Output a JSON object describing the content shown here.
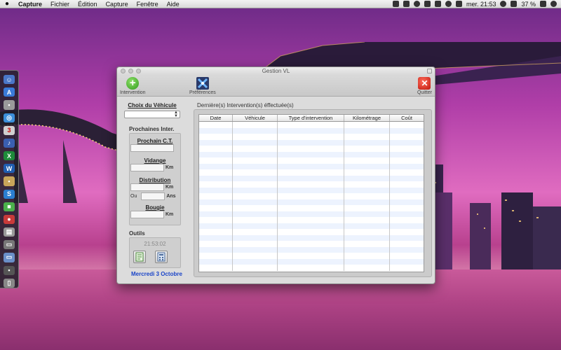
{
  "menubar": {
    "app_name": "Capture",
    "items": [
      "Fichier",
      "Édition",
      "Capture",
      "Fenêtre",
      "Aide"
    ],
    "clock": "mer. 21:53",
    "battery": "37 %"
  },
  "window": {
    "title": "Gestion VL",
    "toolbar": {
      "intervention_label": "Intervention",
      "preferences_label": "Préférences",
      "quit_label": "Quitter"
    },
    "left": {
      "vehicle_label": "Choix du Véhicule",
      "upcoming_title": "Prochaines Inter.",
      "prochain_ct": "Prochain C.T.",
      "vidange": "Vidange",
      "distribution": "Distribution",
      "bougie": "Bougie",
      "unit_km": "Km",
      "unit_ans": "Ans",
      "ou": "Ou",
      "tools_title": "Outils",
      "clock": "21:53:02",
      "date": "Mercredi 3 Octobre"
    },
    "right": {
      "title": "Dernière(s) Intervention(s) éffectuée(s)",
      "columns": [
        "Date",
        "Véhicule",
        "Type d'intervention",
        "Kilométrage",
        "Coût"
      ]
    }
  },
  "colors": {
    "accent_date": "#1a44c8",
    "row_stripe": "#edf3fe"
  }
}
